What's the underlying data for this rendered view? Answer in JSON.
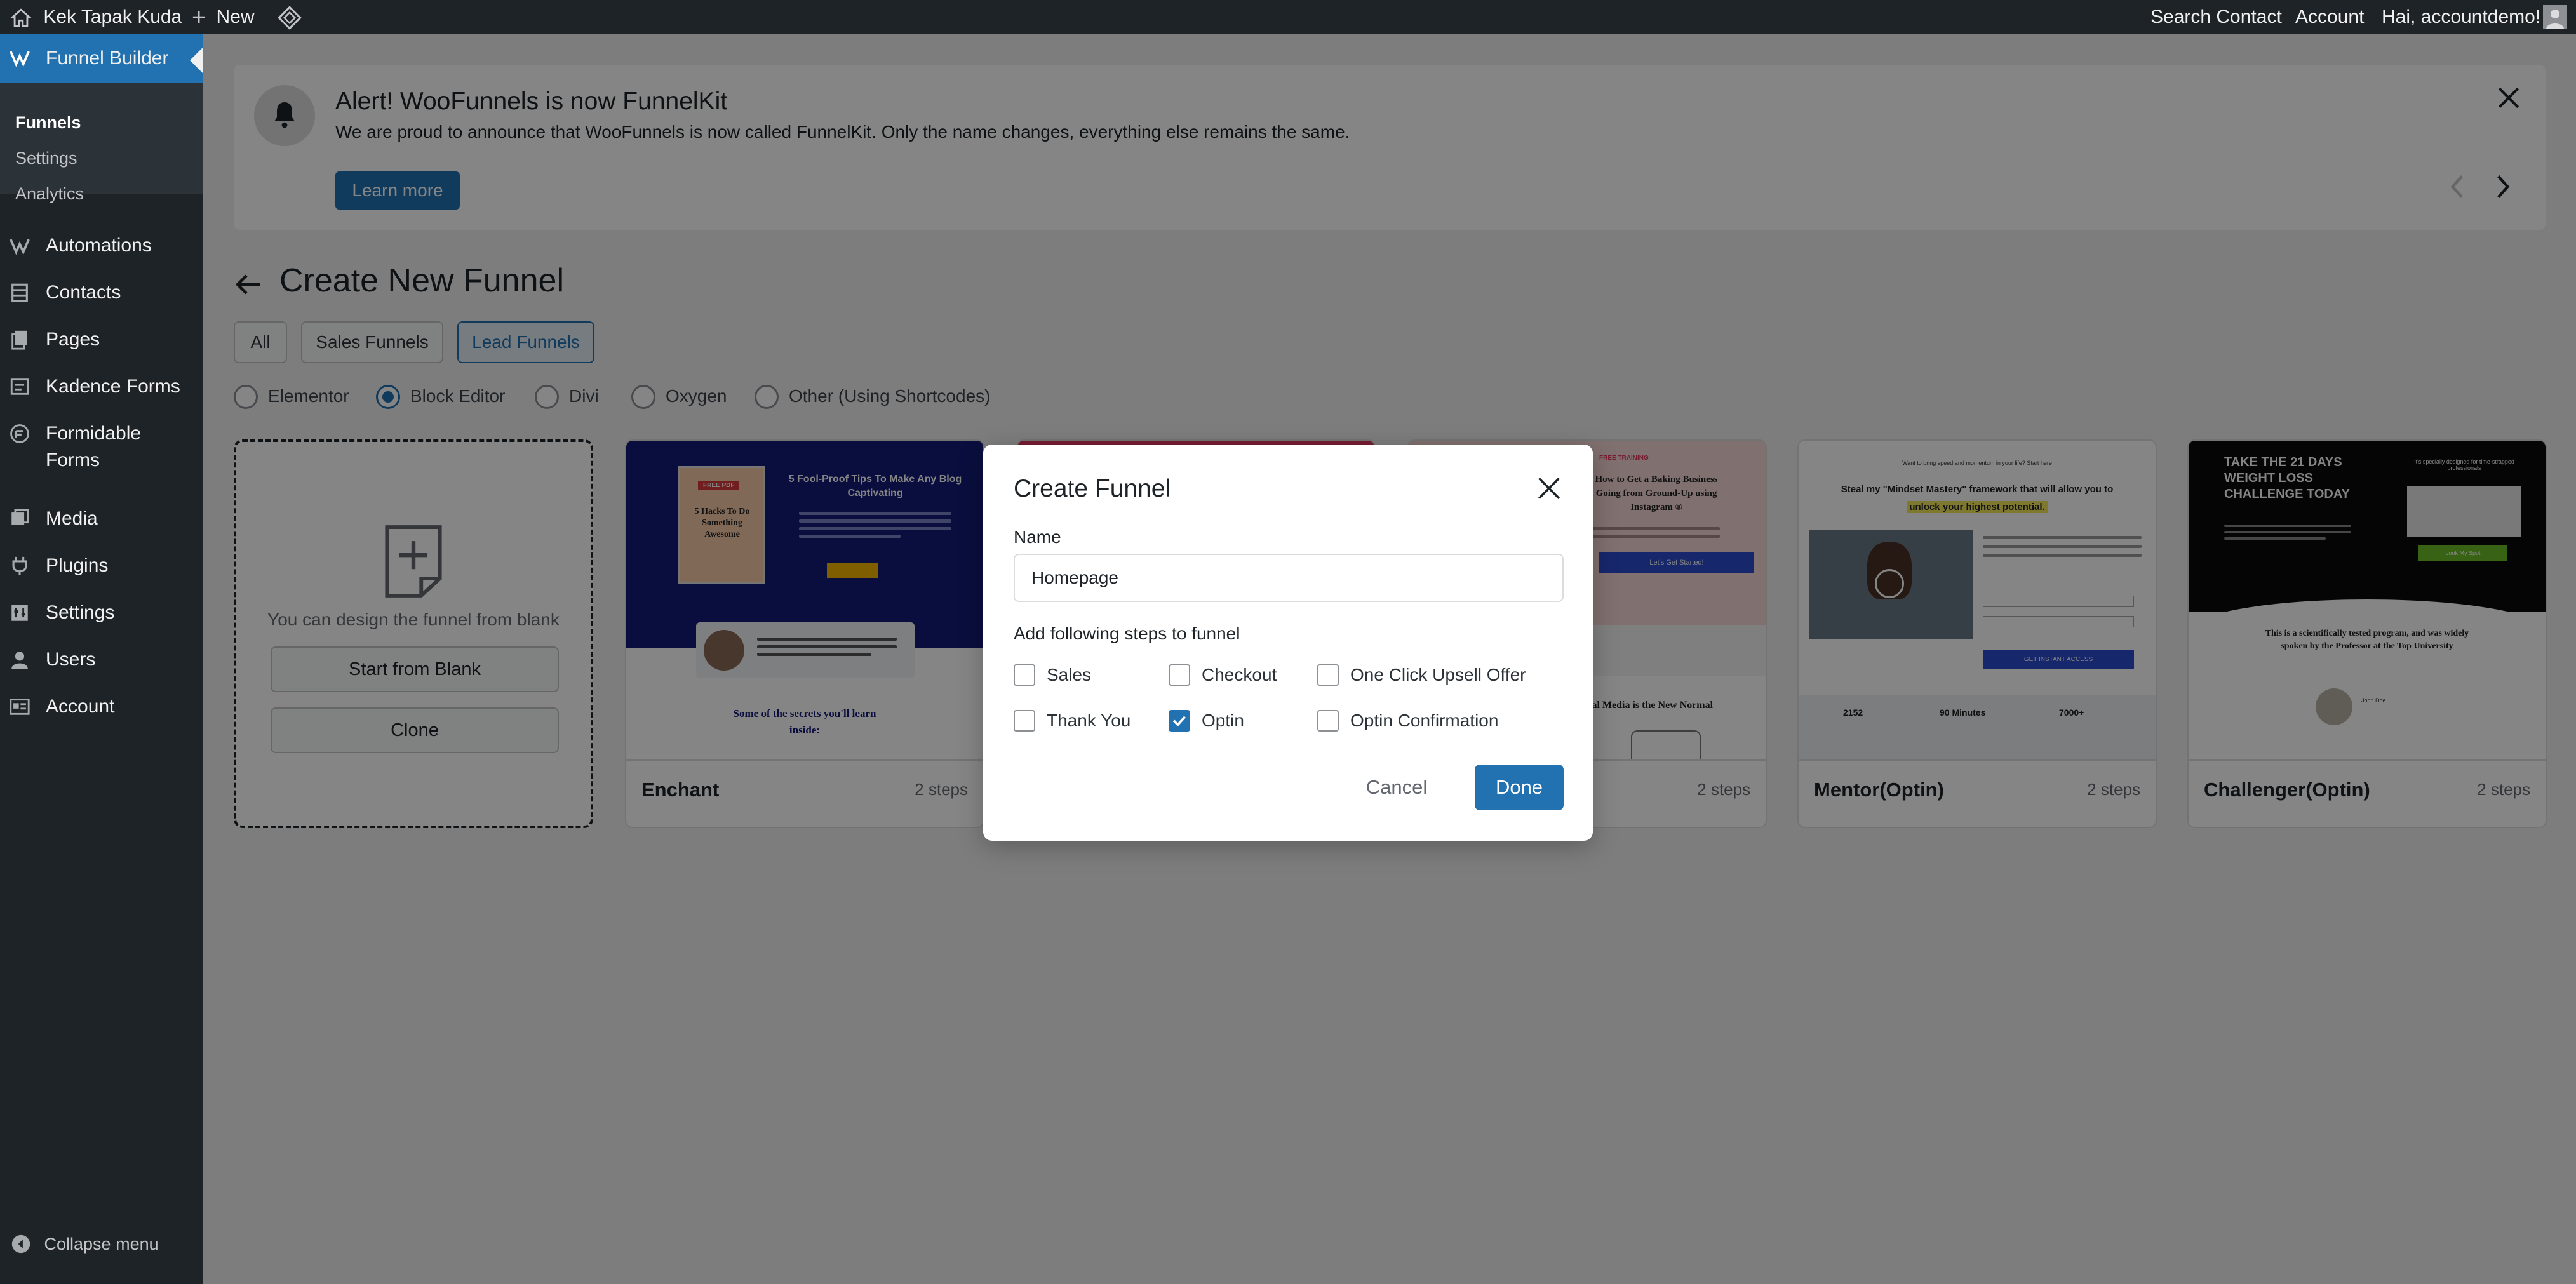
{
  "admin_bar": {
    "site_name": "Kek Tapak Kuda",
    "new_label": "New",
    "search_contact": "Search Contact",
    "account": "Account",
    "greeting": "Hai, accountdemo!"
  },
  "sidebar": {
    "funnel_builder": "Funnel Builder",
    "submenu": [
      "Funnels",
      "Settings",
      "Analytics"
    ],
    "items": [
      "Automations",
      "Contacts",
      "Pages",
      "Kadence Forms",
      "Formidable",
      "Forms",
      "Media",
      "Plugins",
      "Settings",
      "Users",
      "Account"
    ],
    "collapse": "Collapse menu"
  },
  "notice": {
    "title": "Alert! WooFunnels is now FunnelKit",
    "text": "We are proud to announce that WooFunnels is now called FunnelKit. Only the name changes, everything else remains the same.",
    "button": "Learn more"
  },
  "page": {
    "title": "Create New Funnel",
    "tabs": [
      "All",
      "Sales Funnels",
      "Lead Funnels"
    ],
    "active_tab": "Lead Funnels",
    "builders": [
      "Elementor",
      "Block Editor",
      "Divi",
      "Oxygen",
      "Other (Using Shortcodes)"
    ],
    "selected_builder": "Block Editor"
  },
  "blank_card": {
    "hint": "You can design the funnel from blank",
    "start": "Start from Blank",
    "clone": "Clone"
  },
  "templates": [
    {
      "name": "Enchant",
      "steps": "2 steps",
      "thumb_heading": "5 Fool-Proof Tips To Make Any Blog Captivating",
      "thumb_book": "5 Hacks To Do Something Awesome",
      "thumb_badge": "FREE PDF",
      "thumb_footer_1": "Some of the secrets you'll learn",
      "thumb_footer_2": "inside:"
    },
    {
      "name": "",
      "steps": "2 steps",
      "thumb_small": "FREE TRAINING",
      "thumb_heading_1": "How to Get a Baking Business",
      "thumb_heading_2": "Going from Ground-Up using",
      "thumb_heading_3": "Instagram ®",
      "thumb_button": "Let's Get Started!",
      "thumb_footer": "Social Media is the New Normal"
    },
    {
      "name": "Mentor(Optin)",
      "steps": "2 steps",
      "thumb_small": "Want to bring speed and momentum in your life? Start here",
      "thumb_heading": "Steal my \"Mindset Mastery\" framework that will allow you to",
      "thumb_highlight": "unlock your highest potential.",
      "thumb_button": "GET INSTANT ACCESS",
      "stats": [
        "2152",
        "90 Minutes",
        "7000+"
      ]
    },
    {
      "name": "Challenger(Optin)",
      "steps": "2 steps",
      "thumb_heading": "TAKE THE 21 DAYS WEIGHT LOSS CHALLENGE TODAY",
      "thumb_side": "It's specially designed for time-strapped professionals",
      "thumb_button": "Look My Spot",
      "thumb_body": "This is a scientifically tested program, and was widely spoken by the Professor at the Top University",
      "thumb_author": "John Doe"
    }
  ],
  "modal": {
    "title": "Create Funnel",
    "name_label": "Name",
    "name_value": "Homepage",
    "steps_label": "Add following steps to funnel",
    "steps": [
      {
        "label": "Sales",
        "checked": false
      },
      {
        "label": "Checkout",
        "checked": false
      },
      {
        "label": "One Click Upsell Offer",
        "checked": false
      },
      {
        "label": "Thank You",
        "checked": false
      },
      {
        "label": "Optin",
        "checked": true
      },
      {
        "label": "Optin Confirmation",
        "checked": false
      }
    ],
    "cancel": "Cancel",
    "done": "Done"
  },
  "colors": {
    "admin_bar": "#1d2327",
    "accent": "#2271b1",
    "background": "#f0f0f1"
  }
}
